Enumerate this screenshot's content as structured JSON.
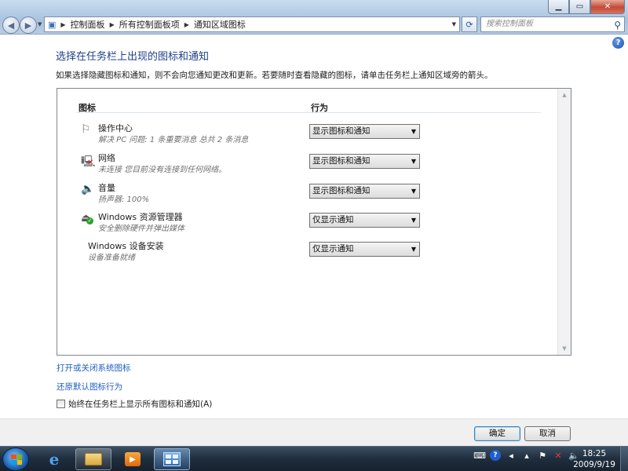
{
  "window": {
    "min_glyph": "▁",
    "max_glyph": "▭",
    "close_glyph": "✕"
  },
  "address": {
    "root_icon": "▣",
    "sep": "▶",
    "crumbs": [
      "控制面板",
      "所有控制面板项",
      "通知区域图标"
    ]
  },
  "search": {
    "placeholder": "搜索控制面板",
    "icon": "⚲"
  },
  "page": {
    "title": "选择在任务栏上出现的图标和通知",
    "description": "如果选择隐藏图标和通知，则不会向您通知更改和更新。若要随时查看隐藏的图标，请单击任务栏上通知区域旁的箭头。"
  },
  "table": {
    "col_icon": "图标",
    "col_behavior": "行为",
    "rows": [
      {
        "name": "操作中心",
        "sub": "解决 PC 问题: 1 条重要消息  总共 2 条消息",
        "behavior": "显示图标和通知",
        "icon": "flag-icon",
        "glyph": "⚐"
      },
      {
        "name": "网络",
        "sub": "未连接 您目前没有连接到任何网络。",
        "behavior": "显示图标和通知",
        "icon": "network-disconnected-icon",
        "glyph": "🖳"
      },
      {
        "name": "音量",
        "sub": "扬声器: 100%",
        "behavior": "显示图标和通知",
        "icon": "speaker-icon",
        "glyph": "🔈"
      },
      {
        "name": "Windows 资源管理器",
        "sub": "安全删除硬件并弹出媒体",
        "behavior": "仅显示通知",
        "icon": "safely-remove-hardware-icon",
        "glyph": "⏏"
      },
      {
        "name": "Windows 设备安装",
        "sub": "设备准备就绪",
        "behavior": "仅显示通知",
        "icon": "",
        "glyph": ""
      }
    ]
  },
  "links": {
    "system_icons": "打开或关闭系统图标",
    "restore_defaults": "还原默认图标行为"
  },
  "checkbox": {
    "label": "始终在任务栏上显示所有图标和通知(A)",
    "checked": false
  },
  "buttons": {
    "ok": "确定",
    "cancel": "取消"
  },
  "taskbar": {
    "time": "18:25",
    "date": "2009/9/19",
    "ie_glyph": "e",
    "media_glyph": "▶"
  },
  "colors": {
    "title_blue": "#1e3f8a",
    "link_blue": "#1f5ec2",
    "taskbar": "#1f2d3d"
  }
}
